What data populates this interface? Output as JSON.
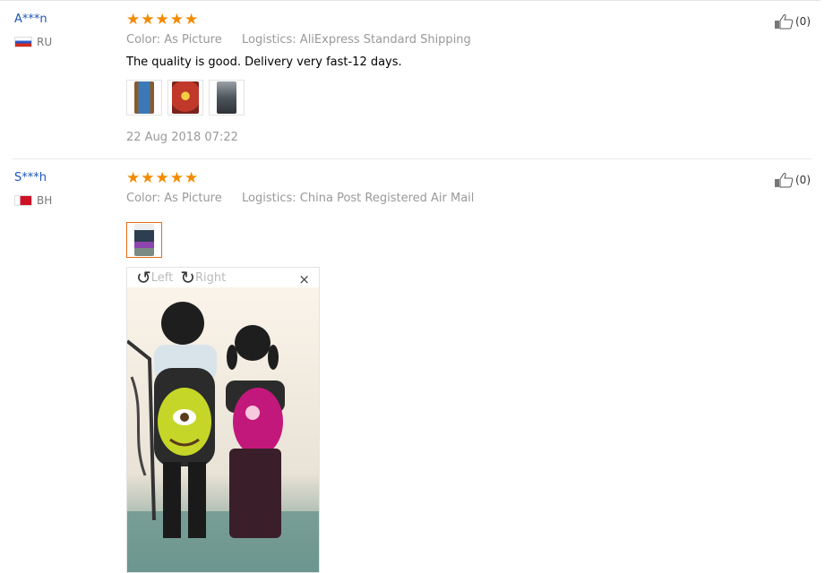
{
  "reviews": [
    {
      "user": "A***n",
      "country": "RU",
      "stars": 5,
      "color_label": "Color:",
      "color_value": "As Picture",
      "logistics_label": "Logistics:",
      "logistics_value": "AliExpress Standard Shipping",
      "text": "The quality is good. Delivery very fast-12 days.",
      "date": "22 Aug 2018 07:22",
      "likes": "(0)"
    },
    {
      "user": "S***h",
      "country": "BH",
      "stars": 5,
      "color_label": "Color:",
      "color_value": "As Picture",
      "logistics_label": "Logistics:",
      "logistics_value": "China Post Registered Air Mail",
      "likes": "(0)"
    }
  ],
  "viewer": {
    "rotate_left": "Left",
    "rotate_right": "Right",
    "close": "×"
  },
  "colors": {
    "user_link": "#1c56b8",
    "star": "#f48a00",
    "muted": "#999999",
    "active_thumb_border": "#e66b12"
  }
}
